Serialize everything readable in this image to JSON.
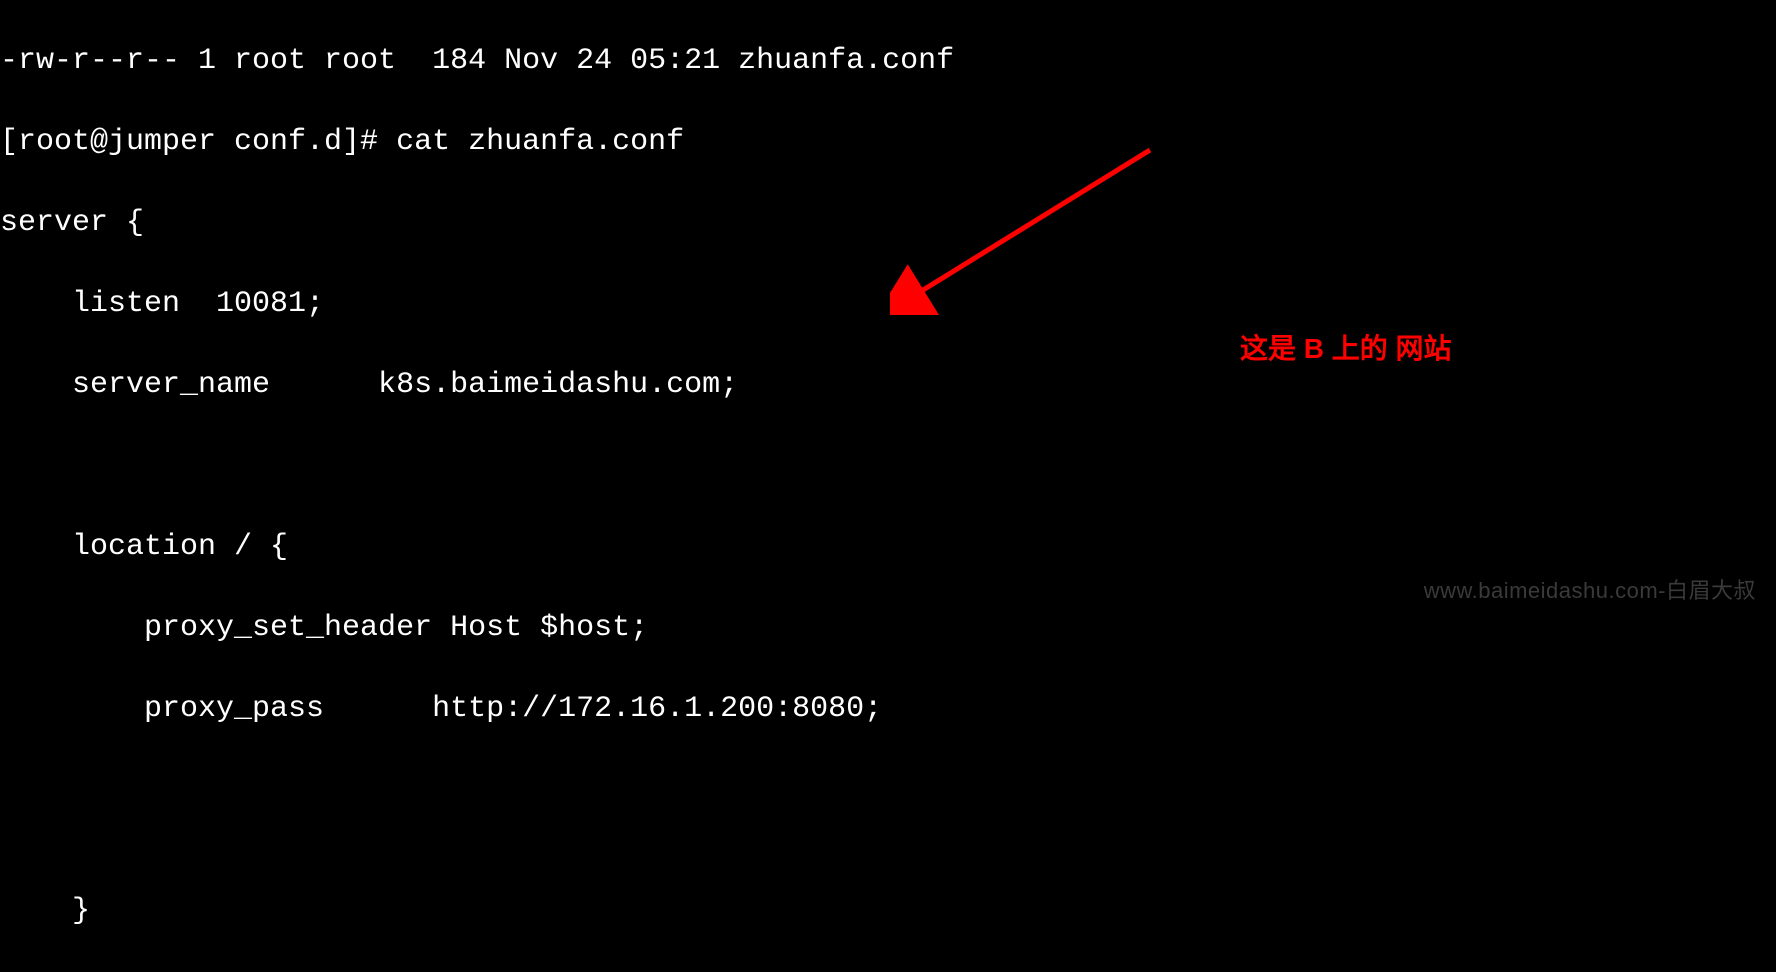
{
  "terminal": {
    "lines": [
      "-rw-r--r-- 1 root root  184 Nov 24 05:21 zhuanfa.conf",
      "[root@jumper conf.d]# cat zhuanfa.conf",
      "server {",
      "    listen  10081;",
      "    server_name      k8s.baimeidashu.com;",
      "",
      "",
      "    location / {",
      "        proxy_set_header Host $host;",
      "        proxy_pass      http://172.16.1.200:8080;",
      "",
      "",
      "",
      "    }"
    ]
  },
  "annotation": {
    "text": "这是 B 上的 网站"
  },
  "watermark": {
    "text": "www.baimeidashu.com-白眉大叔"
  }
}
